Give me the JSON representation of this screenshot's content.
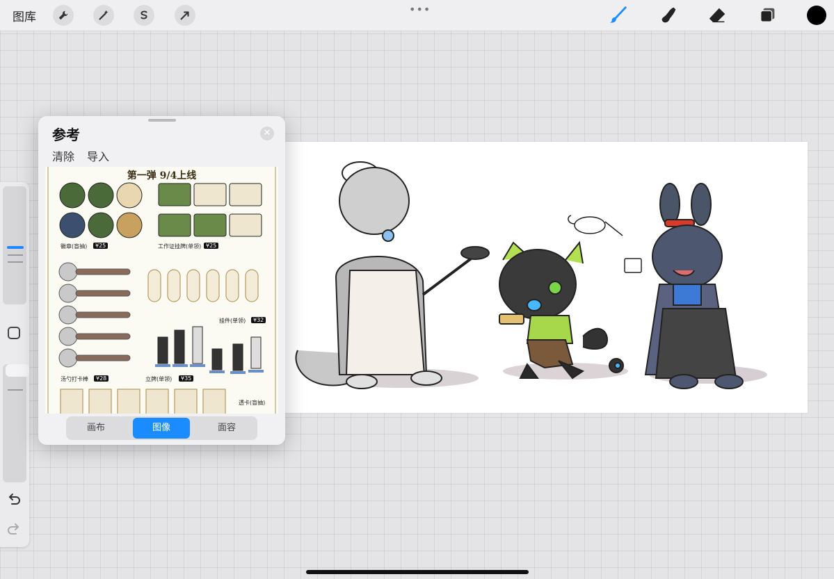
{
  "toolbar": {
    "gallery_label": "图库",
    "left_tools": [
      "wrench-icon",
      "magic-wand-icon",
      "selection-icon",
      "transform-arrow-icon"
    ],
    "right_tools": [
      "brush-icon",
      "smudge-icon",
      "eraser-icon",
      "layers-icon"
    ],
    "active_tool": "brush-icon",
    "active_color": "#000000",
    "accent_color": "#1a8cff"
  },
  "reference": {
    "title": "参考",
    "clear_label": "清除",
    "import_label": "导入",
    "tabs": [
      {
        "label": "画布",
        "active": false
      },
      {
        "label": "图像",
        "active": true
      },
      {
        "label": "面容",
        "active": false
      }
    ],
    "sheet": {
      "title": "第一弹 9/4上线",
      "labels": {
        "badges": "徽章(盲抽)",
        "badges_price": "¥25",
        "work_tag": "工作证挂牌(单领)",
        "work_tag_price": "¥25",
        "pendant": "挂件(单领)",
        "pendant_price": "¥32",
        "ladle": "汤勺打卡棒",
        "ladle_price": "¥28",
        "stand": "立牌(单领)",
        "stand_price": "¥35",
        "card": "透卡(盲抽)"
      }
    }
  }
}
